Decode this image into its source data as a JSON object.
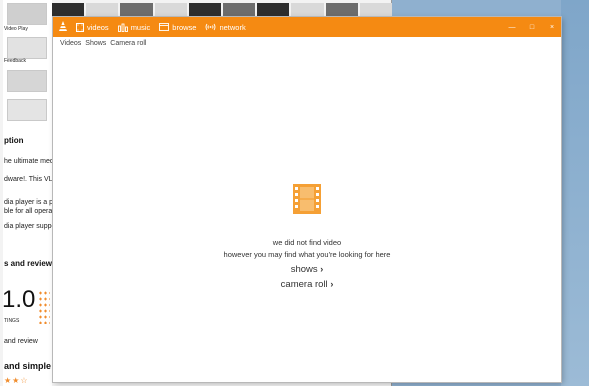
{
  "background_store": {
    "thumb_labels": [
      "Video Play",
      "Feedback"
    ],
    "text_lines": [
      "ption",
      "he ultimate media",
      "dware!. This VLC",
      "dia player is a po",
      "ble for all operati",
      "dia player suppo"
    ],
    "headings": [
      "s and reviews",
      "and simple"
    ],
    "score": "1.0",
    "ratings_label": "TINGS",
    "review_link": "and review",
    "stars": "★★☆"
  },
  "window": {
    "accent": "#f58a12",
    "nav": [
      {
        "label": "videos",
        "icon": "video-icon"
      },
      {
        "label": "music",
        "icon": "music-icon"
      },
      {
        "label": "browse",
        "icon": "folder-icon"
      },
      {
        "label": "network",
        "icon": "network-icon"
      }
    ],
    "controls": {
      "minimize": "—",
      "maximize": "□",
      "close": "×"
    }
  },
  "subnav": {
    "items": [
      "Videos",
      "Shows",
      "Camera roll"
    ]
  },
  "empty_state": {
    "icon": "film-icon",
    "line1": "we did not find video",
    "line2": "however you may find what you're looking for here",
    "links": [
      {
        "label": "shows",
        "chevron": "›"
      },
      {
        "label": "camera roll",
        "chevron": "›"
      }
    ]
  }
}
